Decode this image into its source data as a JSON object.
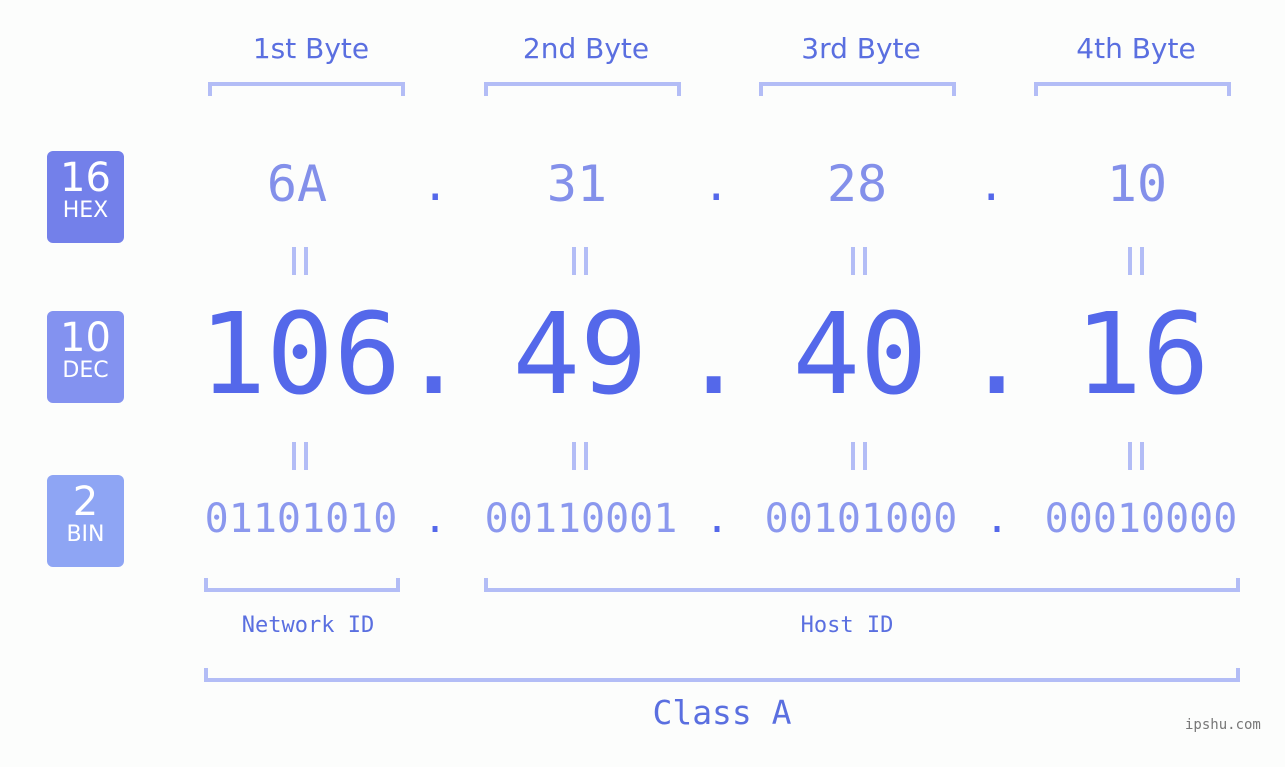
{
  "byte_headers": [
    "1st Byte",
    "2nd Byte",
    "3rd Byte",
    "4th Byte"
  ],
  "badges": [
    {
      "base": "16",
      "label": "HEX",
      "color": "#7380ea"
    },
    {
      "base": "10",
      "label": "DEC",
      "color": "#8392f0"
    },
    {
      "base": "2",
      "label": "BIN",
      "color": "#8ea5f4"
    }
  ],
  "hex": [
    "6A",
    "31",
    "28",
    "10"
  ],
  "dec": [
    "106",
    "49",
    "40",
    "16"
  ],
  "bin": [
    "01101010",
    "00110001",
    "00101000",
    "00010000"
  ],
  "separator": ".",
  "network_id_label": "Network ID",
  "host_id_label": "Host ID",
  "class_label": "Class A",
  "watermark": "ipshu.com",
  "colors": {
    "accent": "#5468ea",
    "light_accent": "#b3bdf6",
    "hex_text": "#8390ea",
    "bin_text": "#8b98ee"
  }
}
